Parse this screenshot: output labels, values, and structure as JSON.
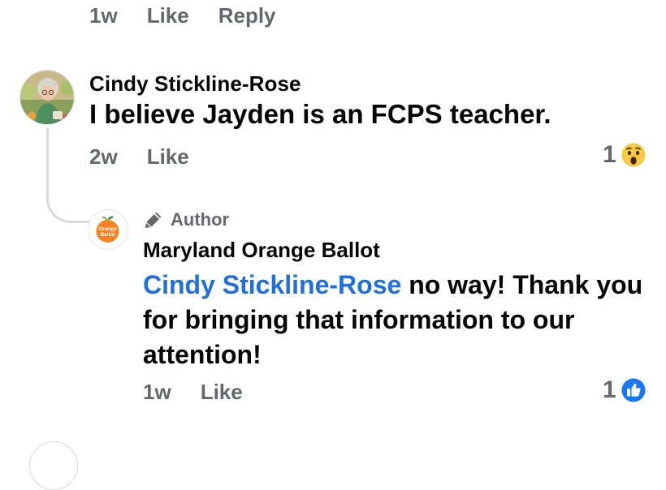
{
  "top_actions": {
    "time": "1w",
    "like": "Like",
    "reply": "Reply"
  },
  "comment": {
    "author": "Cindy Stickline-Rose",
    "text": "I believe Jayden is an FCPS teacher.",
    "time": "2w",
    "like": "Like",
    "reaction_count": "1",
    "reaction_icon": "wow-emoji-icon"
  },
  "reply": {
    "badge": "Author",
    "badge_icon": "pencil-icon",
    "author": "Maryland Orange Ballot",
    "avatar_text": [
      "Orange",
      "Ballot"
    ],
    "mention": "Cindy Stickline-Rose",
    "text": " no way! Thank you for bringing that information to our attention!",
    "time": "1w",
    "like": "Like",
    "reaction_count": "1",
    "reaction_icon": "like-thumb-icon"
  },
  "colors": {
    "meta_gray": "#65676b",
    "mention_blue": "#216fdb",
    "like_blue": "#1877f2",
    "wow_yellow": "#f7c843",
    "orange": "#f5821f"
  }
}
